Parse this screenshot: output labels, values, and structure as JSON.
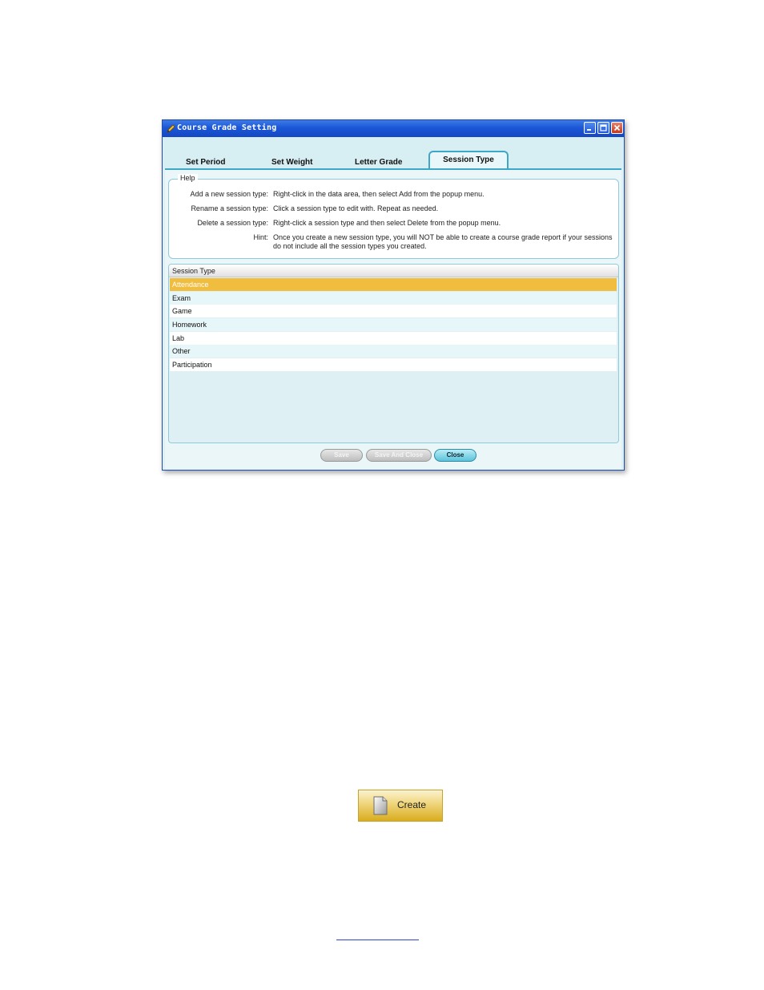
{
  "window": {
    "title": "Course Grade Setting",
    "controls": [
      "minimize",
      "maximize",
      "close"
    ]
  },
  "tabs": [
    {
      "label": "Set Period",
      "active": false
    },
    {
      "label": "Set Weight",
      "active": false
    },
    {
      "label": "Letter Grade",
      "active": false
    },
    {
      "label": "Session Type",
      "active": true
    }
  ],
  "help": {
    "legend": "Help",
    "rows": [
      {
        "label": "Add a new session type:",
        "text": "Right-click in the data area, then select Add from the popup menu."
      },
      {
        "label": "Rename a session type:",
        "text": "Click a session type to edit with. Repeat as needed."
      },
      {
        "label": "Delete a session type:",
        "text": "Right-click a session type and then select Delete from the popup menu."
      },
      {
        "label": "Hint:",
        "text": "Once you create a new session type, you will NOT be able to create a course grade report if your sessions do not include all the session types you created."
      }
    ]
  },
  "table": {
    "header": "Session Type",
    "rows": [
      "Attendance",
      "Exam",
      "Game",
      "Homework",
      "Lab",
      "Other",
      "Participation"
    ],
    "selected_row": "Attendance"
  },
  "buttons": {
    "save": "Save",
    "save_and_close": "Save And Close",
    "close": "Close"
  },
  "create_button": {
    "label": "Create",
    "icon": "document-icon"
  },
  "colors": {
    "titlebar": "#1b57d6",
    "tab_accent": "#3ea6c6",
    "selected_row": "#f0bd3f",
    "create_gold": "#d9ac1e"
  }
}
